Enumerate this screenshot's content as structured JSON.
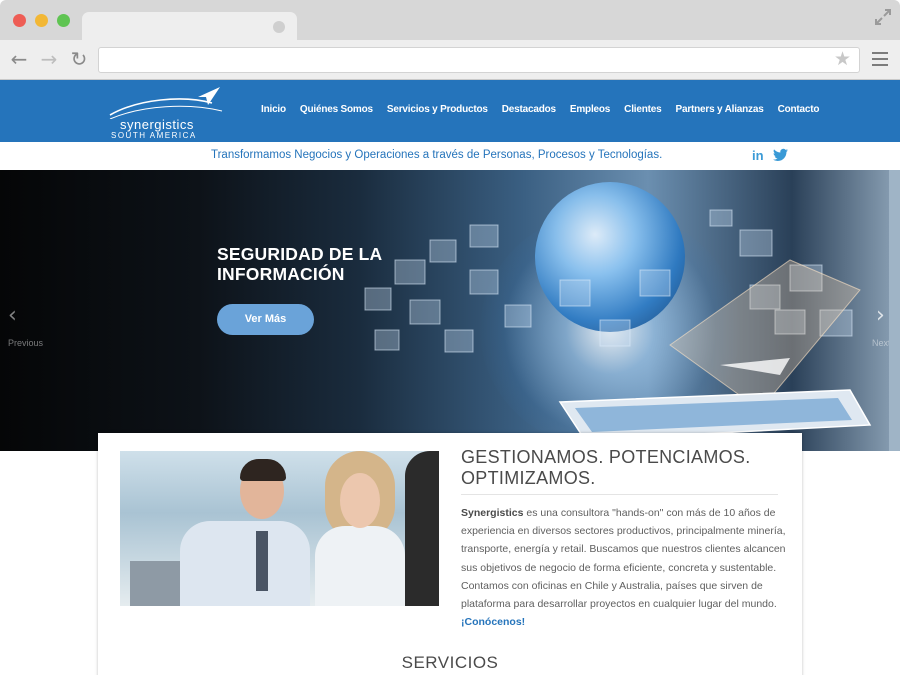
{
  "browser": {
    "url": "",
    "icons": [
      "back-arrow-icon",
      "forward-arrow-icon",
      "reload-icon",
      "star-icon",
      "menu-icon",
      "fullscreen-icon"
    ]
  },
  "header": {
    "logo_name": "synergistics",
    "logo_sub": "SOUTH AMERICA",
    "nav": [
      "Inicio",
      "Quiénes Somos",
      "Servicios y Productos",
      "Destacados",
      "Empleos",
      "Clientes",
      "Partners y Alianzas",
      "Contacto"
    ],
    "brand_color": "#2574bb"
  },
  "tagline": {
    "text": "Transformamos Negocios y Operaciones a través de Personas, Procesos y Tecnologías.",
    "social": [
      "linkedin-icon",
      "twitter-icon"
    ]
  },
  "hero": {
    "title_line1": "SEGURIDAD DE LA",
    "title_line2": "INFORMACIÓN",
    "button": "Ver Más",
    "prev_label": "Previous",
    "next_label": "Next"
  },
  "about": {
    "title_line1": "GESTIONAMOS. POTENCIAMOS.",
    "title_line2": "OPTIMIZAMOS.",
    "company": "Synergistics",
    "body": " es una consultora \"hands-on\" con más de 10 años de experiencia en diversos sectores productivos, principalmente minería, transporte, energía y retail. Buscamos que nuestros clientes alcancen sus objetivos de negocio de forma eficiente, concreta y sustentable. Contamos con oficinas en Chile y Australia, países que sirven de plataforma para desarrollar proyectos en cualquier lugar del mundo. ",
    "link": "¡Conócenos!"
  },
  "services": {
    "title": "SERVICIOS"
  }
}
